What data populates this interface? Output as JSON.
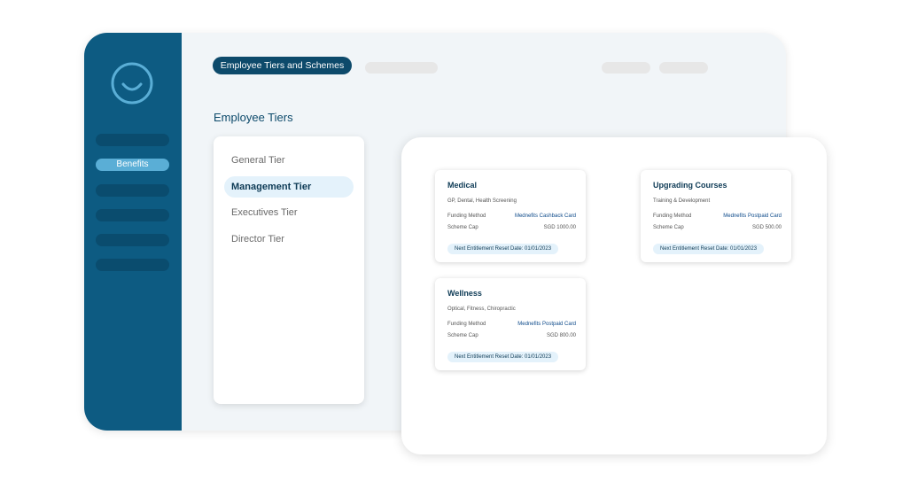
{
  "header": {
    "active_tab": "Employee Tiers and Schemes"
  },
  "sidebar": {
    "items": [
      {
        "label": ""
      },
      {
        "label": "Benefits",
        "active": true
      },
      {
        "label": ""
      },
      {
        "label": ""
      },
      {
        "label": ""
      },
      {
        "label": ""
      }
    ],
    "logo_icon": "smiley-logo-icon"
  },
  "main": {
    "section_title": "Employee Tiers",
    "tiers": [
      {
        "label": "General Tier",
        "selected": false
      },
      {
        "label": "Management Tier",
        "selected": true
      },
      {
        "label": "Executives Tier",
        "selected": false
      },
      {
        "label": "Director Tier",
        "selected": false
      }
    ]
  },
  "schemes": [
    {
      "name": "Medical",
      "description": "GP, Dental, Health Screening",
      "funding_label": "Funding Method",
      "funding_value": "Mednefits Cashback Card",
      "cap_label": "Scheme Cap",
      "cap_value": "SGD 1000.00",
      "reset": "Next Entitlement Reset Date: 01/01/2023"
    },
    {
      "name": "Upgrading Courses",
      "description": "Training & Development",
      "funding_label": "Funding Method",
      "funding_value": "Mednefits Postpaid Card",
      "cap_label": "Scheme Cap",
      "cap_value": "SGD 500.00",
      "reset": "Next Entitlement Reset Date: 01/01/2023"
    },
    {
      "name": "Wellness",
      "description": "Optical, Fitness, Chiropractic",
      "funding_label": "Funding Method",
      "funding_value": "Mednefits Postpaid Card",
      "cap_label": "Scheme Cap",
      "cap_value": "SGD 800.00",
      "reset": "Next Entitlement Reset Date: 01/01/2023"
    }
  ],
  "colors": {
    "sidebar": "#0d5b82",
    "accent_dark": "#0d4a6b",
    "accent_light": "#5aaed6",
    "selected_bg": "#e4f2fb"
  }
}
